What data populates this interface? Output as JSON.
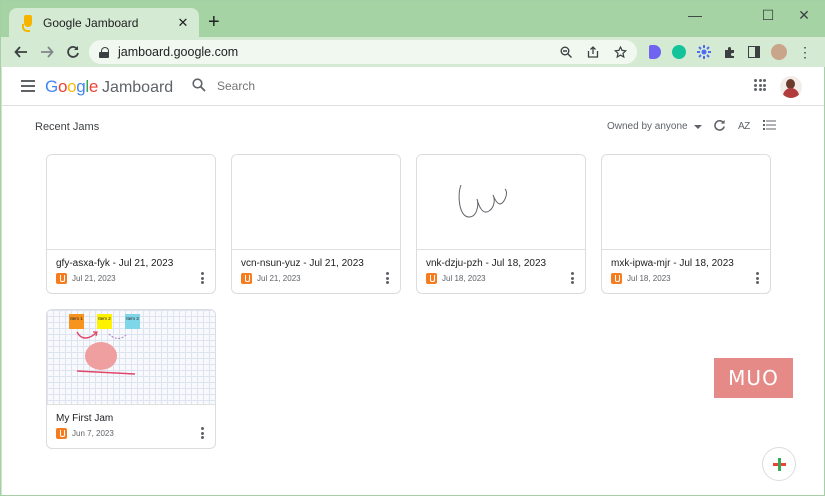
{
  "browser": {
    "tab_title": "Google Jamboard",
    "tab_close": "✕",
    "new_tab": "+",
    "url": "jamboard.google.com",
    "window_controls": [
      "—",
      "☐",
      "✕"
    ]
  },
  "app": {
    "logo_word": "Google",
    "logo_colors": [
      "#4285f4",
      "#ea4335",
      "#fbbc05",
      "#4285f4",
      "#34a853",
      "#ea4335"
    ],
    "product": "Jamboard",
    "search_placeholder": "Search"
  },
  "list": {
    "section_title": "Recent Jams",
    "owner_filter": "Owned by anyone",
    "sort_label": "AZ"
  },
  "jams": [
    {
      "title": "gfy-asxa-fyk - Jul 21, 2023",
      "date": "Jul 21, 2023"
    },
    {
      "title": "vcn-nsun-yuz - Jul 21, 2023",
      "date": "Jul 21, 2023"
    },
    {
      "title": "vnk-dzju-pzh - Jul 18, 2023",
      "date": "Jul 18, 2023"
    },
    {
      "title": "mxk-ipwa-mjr - Jul 18, 2023",
      "date": "Jul 18, 2023"
    },
    {
      "title": "My First Jam",
      "date": "Jun 7, 2023"
    }
  ],
  "first_jam_notes": [
    {
      "label": "Item 1",
      "color": "#f7941d"
    },
    {
      "label": "Item 2",
      "color": "#fff200"
    },
    {
      "label": "Item 3",
      "color": "#7fd6e8"
    }
  ],
  "watermark": "MUO"
}
